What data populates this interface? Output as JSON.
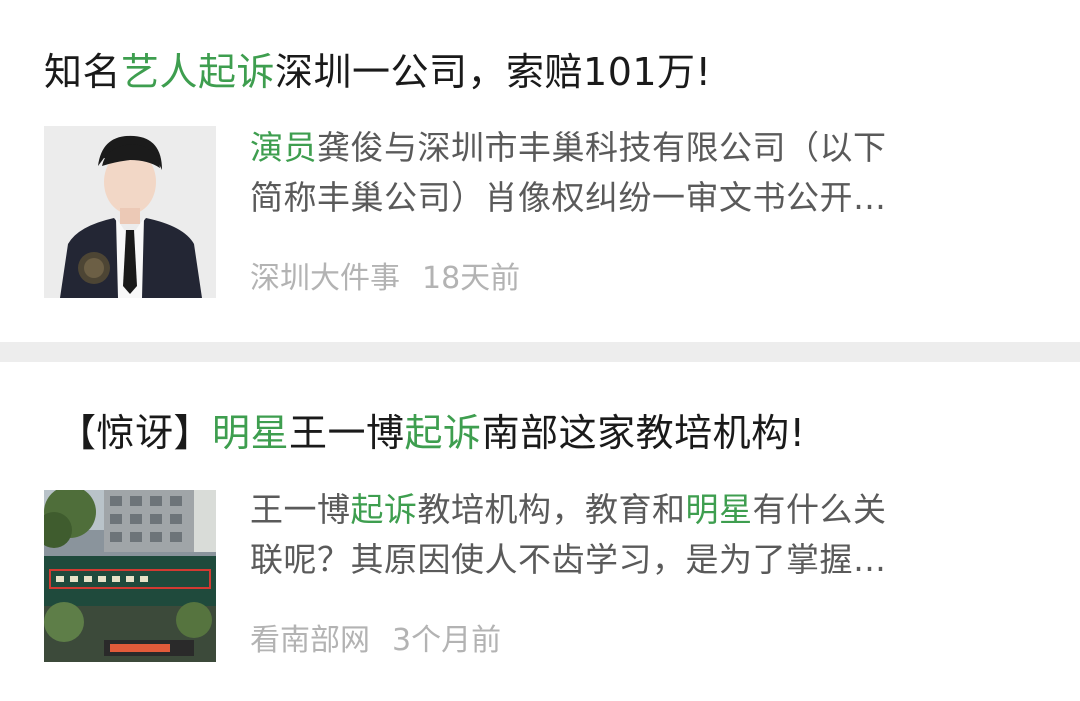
{
  "articles": [
    {
      "title_parts": [
        {
          "text": "知名",
          "hl": false
        },
        {
          "text": "艺人起诉",
          "hl": true
        },
        {
          "text": "深圳一公司，索赔101万!",
          "hl": false
        }
      ],
      "summary_line1_parts": [
        {
          "text": "演员",
          "hl": true
        },
        {
          "text": "龚俊与深圳市丰巢科技有限公司（以下",
          "hl": false
        }
      ],
      "summary_line2": "简称丰巢公司）肖像权纠纷一审文书公开…",
      "source": "深圳大件事",
      "time": "18天前",
      "thumbnail_icon": "person-portrait-image"
    },
    {
      "title_parts": [
        {
          "text": "【惊讶】",
          "hl": false
        },
        {
          "text": "明星",
          "hl": true
        },
        {
          "text": "王一博",
          "hl": false
        },
        {
          "text": "起诉",
          "hl": true
        },
        {
          "text": "南部这家教培机构!",
          "hl": false
        }
      ],
      "summary_line1_parts": [
        {
          "text": "王一博",
          "hl": false
        },
        {
          "text": "起诉",
          "hl": true
        },
        {
          "text": "教培机构，教育和",
          "hl": false
        },
        {
          "text": "明星",
          "hl": true
        },
        {
          "text": "有什么关",
          "hl": false
        }
      ],
      "summary_line2": "联呢？其原因使人不齿学习，是为了掌握…",
      "source": "看南部网",
      "time": "3个月前",
      "thumbnail_icon": "building-storefront-image"
    }
  ],
  "colors": {
    "highlight": "#3e9e4f",
    "divider": "#ededed",
    "meta": "#b3b3b3"
  }
}
